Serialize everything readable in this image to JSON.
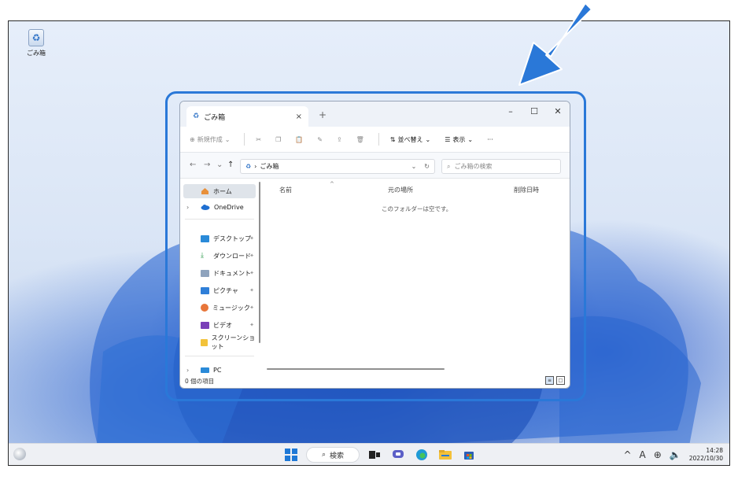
{
  "desktop": {
    "recycle_bin_label": "ごみ箱"
  },
  "window": {
    "tab_title": "ごみ箱",
    "tab_close": "×",
    "new_tab": "+",
    "minimize": "–",
    "maximize": "☐",
    "close": "✕"
  },
  "toolbar": {
    "new_label": "新規作成",
    "sort_label": "並べ替え",
    "view_label": "表示",
    "more_label": "···"
  },
  "address": {
    "path": "ごみ箱",
    "search_placeholder": "ごみ箱の検索"
  },
  "nav": {
    "home": "ホーム",
    "onedrive": "OneDrive",
    "desktop": "デスクトップ",
    "downloads": "ダウンロード",
    "documents": "ドキュメント",
    "pictures": "ピクチャ",
    "music": "ミュージック",
    "videos": "ビデオ",
    "screenshots": "スクリーンショット",
    "pc": "PC"
  },
  "columns": {
    "name": "名前",
    "original_location": "元の場所",
    "date_deleted": "削除日時"
  },
  "content": {
    "empty_message": "このフォルダーは空です。"
  },
  "status": {
    "item_count": "0 個の項目"
  },
  "taskbar": {
    "search_label": "検索",
    "ime_label": "A",
    "time": "14:28",
    "date": "2022/10/30"
  },
  "colors": {
    "accent": "#2a78d8",
    "taskbar_bg": "#eef0f4"
  }
}
